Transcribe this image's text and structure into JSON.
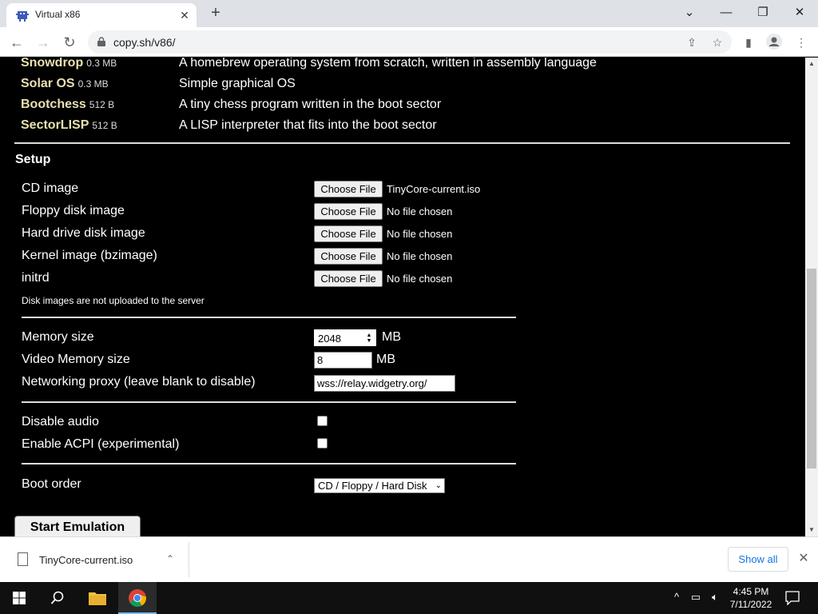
{
  "browser": {
    "tab_title": "Virtual x86",
    "tab_close": "✕",
    "new_tab": "+",
    "url": "copy.sh/v86/",
    "window_controls": {
      "minimize": "—",
      "restore": "❐",
      "close": "✕",
      "tab_search": "⌄"
    }
  },
  "os_list": [
    {
      "name": "Snowdrop",
      "size": "0.3 MB",
      "description": "A homebrew operating system from scratch, written in assembly language"
    },
    {
      "name": "Solar OS",
      "size": "0.3 MB",
      "description": "Simple graphical OS"
    },
    {
      "name": "Bootchess",
      "size": "512 B",
      "description": "A tiny chess program written in the boot sector"
    },
    {
      "name": "SectorLISP",
      "size": "512 B",
      "description": "A LISP interpreter that fits into the boot sector"
    }
  ],
  "setup": {
    "title": "Setup",
    "choose_file_label": "Choose File",
    "files": [
      {
        "label": "CD image",
        "status": "TinyCore-current.iso"
      },
      {
        "label": "Floppy disk image",
        "status": "No file chosen"
      },
      {
        "label": "Hard drive disk image",
        "status": "No file chosen"
      },
      {
        "label": "Kernel image (bzimage)",
        "status": "No file chosen"
      },
      {
        "label": "initrd",
        "status": "No file chosen"
      }
    ],
    "note": "Disk images are not uploaded to the server",
    "memory": {
      "label": "Memory size",
      "value": "2048",
      "unit": "MB"
    },
    "video_memory": {
      "label": "Video Memory size",
      "value": "8",
      "unit": "MB"
    },
    "network": {
      "label": "Networking proxy (leave blank to disable)",
      "value": "wss://relay.widgetry.org/"
    },
    "disable_audio": {
      "label": "Disable audio",
      "checked": false
    },
    "enable_acpi": {
      "label": "Enable ACPI (experimental)",
      "checked": false
    },
    "boot_order": {
      "label": "Boot order",
      "value": "CD / Floppy / Hard Disk"
    },
    "start_button": "Start Emulation"
  },
  "download_bar": {
    "filename": "TinyCore-current.iso",
    "show_all": "Show all",
    "close": "✕"
  },
  "taskbar": {
    "time": "4:45 PM",
    "date": "7/11/2022"
  }
}
